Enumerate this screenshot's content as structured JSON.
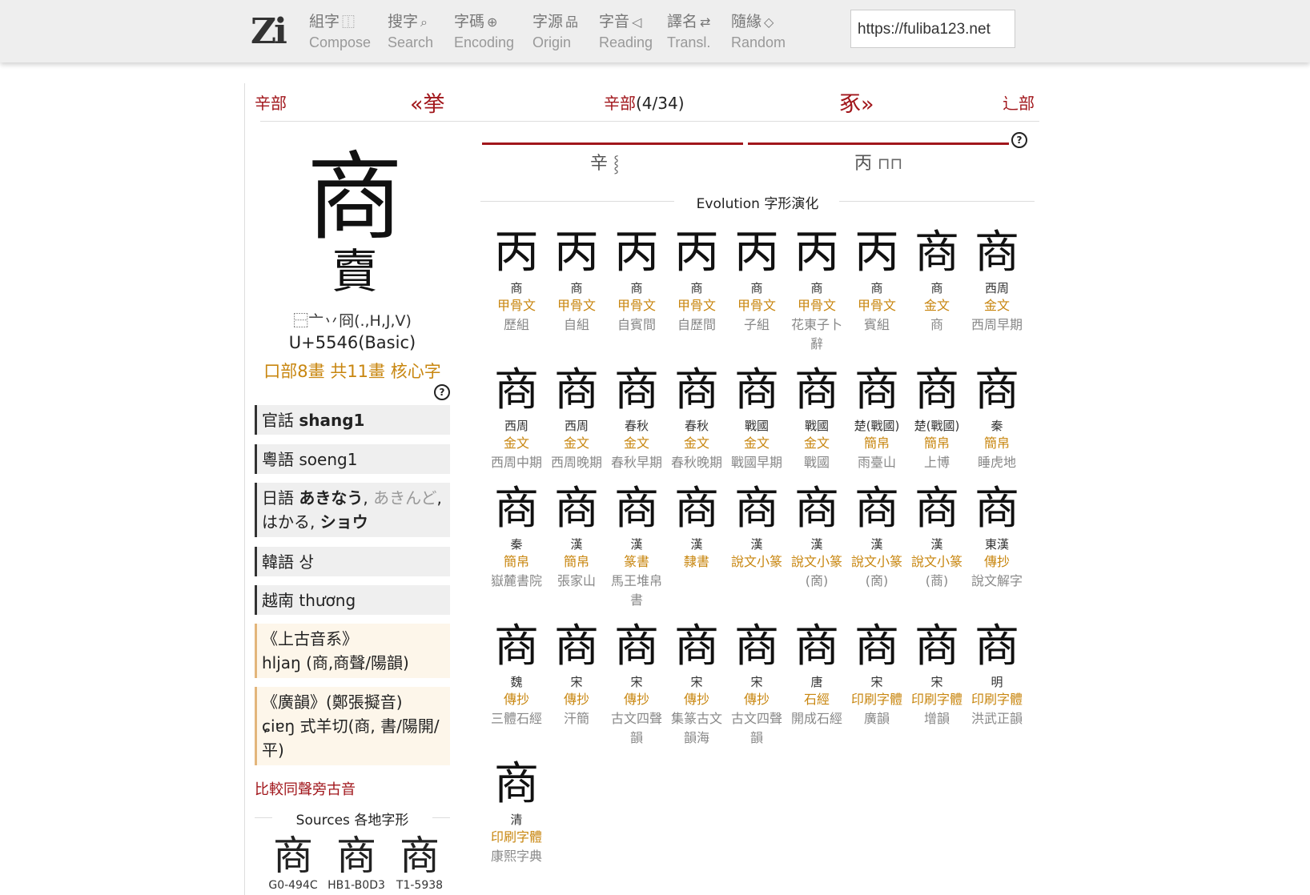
{
  "logo": "Zi",
  "nav": [
    {
      "zh": "組字",
      "icon": "⿰",
      "en": "Compose"
    },
    {
      "zh": "搜字",
      "icon": "⌕",
      "en": "Search"
    },
    {
      "zh": "字碼",
      "icon": "⊕",
      "en": "Encoding"
    },
    {
      "zh": "字源",
      "icon": "品",
      "en": "Origin"
    },
    {
      "zh": "字音",
      "icon": "◁",
      "en": "Reading"
    },
    {
      "zh": "譯名",
      "icon": "⇄",
      "en": "Transl."
    },
    {
      "zh": "隨緣",
      "icon": "◇",
      "en": "Random"
    }
  ],
  "url": "https://fuliba123.net",
  "radical_nav": {
    "prev_radical": "辛部",
    "prev_char": "«挙",
    "current": "辛部",
    "position": "(4/34)",
    "next_char": "豖»",
    "next_radical": "辶部"
  },
  "character": {
    "main": "商",
    "seal": "𧶠",
    "decomposition": "⿱亠丷冏(.,H,J,V)",
    "unicode": "U+5546(Basic)",
    "radical_info": "口部8畫 共11畫 核心字"
  },
  "pronunciations": {
    "mandarin": {
      "label": "官話",
      "value": "shang1"
    },
    "cantonese": {
      "label": "粵語",
      "value": "soeng1"
    },
    "japanese": {
      "label": "日語",
      "kun1": "あきなう",
      "kun2": "あきんど",
      "kun3": "はかる",
      "on": "ショウ"
    },
    "korean": {
      "label": "韓語",
      "value": "상"
    },
    "vietnamese": {
      "label": "越南",
      "value": "thương"
    },
    "old_chinese": {
      "title": "《上古音系》",
      "value": "hljaŋ (商,商聲/陽韻)"
    },
    "guangyun": {
      "title": "《廣韻》(鄭張擬音)",
      "value": "ɕiɐŋ 式羊切(商, 書/陽開/平)"
    }
  },
  "compare_link": "比較同聲旁古音",
  "sources": {
    "title": "Sources 各地字形",
    "items": [
      {
        "char": "商",
        "code": "G0-494C"
      },
      {
        "char": "商",
        "code": "HB1-B0D3"
      },
      {
        "char": "商",
        "code": "T1-5938"
      }
    ]
  },
  "components": [
    {
      "char": "辛",
      "pic": "⸾"
    },
    {
      "char": "丙",
      "pic": "⊓⊓"
    }
  ],
  "evolution": {
    "title": "Evolution 字形演化",
    "items": [
      {
        "glyph": "丙",
        "era": "商",
        "type": "甲骨文",
        "src": "歷組"
      },
      {
        "glyph": "丙",
        "era": "商",
        "type": "甲骨文",
        "src": "自組"
      },
      {
        "glyph": "丙",
        "era": "商",
        "type": "甲骨文",
        "src": "自賓間"
      },
      {
        "glyph": "丙",
        "era": "商",
        "type": "甲骨文",
        "src": "自歷間"
      },
      {
        "glyph": "丙",
        "era": "商",
        "type": "甲骨文",
        "src": "子組"
      },
      {
        "glyph": "丙",
        "era": "商",
        "type": "甲骨文",
        "src": "花東子卜辭"
      },
      {
        "glyph": "丙",
        "era": "商",
        "type": "甲骨文",
        "src": "賓組"
      },
      {
        "glyph": "商",
        "era": "商",
        "type": "金文",
        "src": "商"
      },
      {
        "glyph": "商",
        "era": "西周",
        "type": "金文",
        "src": "西周早期"
      },
      {
        "glyph": "商",
        "era": "西周",
        "type": "金文",
        "src": "西周中期"
      },
      {
        "glyph": "商",
        "era": "西周",
        "type": "金文",
        "src": "西周晚期"
      },
      {
        "glyph": "商",
        "era": "春秋",
        "type": "金文",
        "src": "春秋早期"
      },
      {
        "glyph": "商",
        "era": "春秋",
        "type": "金文",
        "src": "春秋晚期"
      },
      {
        "glyph": "商",
        "era": "戰國",
        "type": "金文",
        "src": "戰國早期"
      },
      {
        "glyph": "商",
        "era": "戰國",
        "type": "金文",
        "src": "戰國"
      },
      {
        "glyph": "商",
        "era": "楚(戰國)",
        "type": "簡帛",
        "src": "雨臺山"
      },
      {
        "glyph": "商",
        "era": "楚(戰國)",
        "type": "簡帛",
        "src": "上博"
      },
      {
        "glyph": "商",
        "era": "秦",
        "type": "簡帛",
        "src": "睡虎地"
      },
      {
        "glyph": "商",
        "era": "秦",
        "type": "簡帛",
        "src": "嶽麓書院"
      },
      {
        "glyph": "商",
        "era": "漢",
        "type": "簡帛",
        "src": "張家山"
      },
      {
        "glyph": "商",
        "era": "漢",
        "type": "篆書",
        "src": "馬王堆帛書"
      },
      {
        "glyph": "商",
        "era": "漢",
        "type": "隸書",
        "src": ""
      },
      {
        "glyph": "商",
        "era": "漢",
        "type": "說文小篆",
        "src": ""
      },
      {
        "glyph": "商",
        "era": "漢",
        "type": "說文小篆",
        "src": "(啇)"
      },
      {
        "glyph": "商",
        "era": "漢",
        "type": "說文小篆",
        "src": "(啇)"
      },
      {
        "glyph": "商",
        "era": "漢",
        "type": "說文小篆",
        "src": "(蔏)"
      },
      {
        "glyph": "商",
        "era": "東漢",
        "type": "傳抄",
        "src": "說文解字"
      },
      {
        "glyph": "商",
        "era": "魏",
        "type": "傳抄",
        "src": "三體石經"
      },
      {
        "glyph": "商",
        "era": "宋",
        "type": "傳抄",
        "src": "汗簡"
      },
      {
        "glyph": "商",
        "era": "宋",
        "type": "傳抄",
        "src": "古文四聲韻"
      },
      {
        "glyph": "商",
        "era": "宋",
        "type": "傳抄",
        "src": "集篆古文韻海"
      },
      {
        "glyph": "商",
        "era": "宋",
        "type": "傳抄",
        "src": "古文四聲韻"
      },
      {
        "glyph": "商",
        "era": "唐",
        "type": "石經",
        "src": "開成石經"
      },
      {
        "glyph": "商",
        "era": "宋",
        "type": "印刷字體",
        "src": "廣韻"
      },
      {
        "glyph": "商",
        "era": "宋",
        "type": "印刷字體",
        "src": "增韻"
      },
      {
        "glyph": "商",
        "era": "明",
        "type": "印刷字體",
        "src": "洪武正韻"
      },
      {
        "glyph": "商",
        "era": "清",
        "type": "印刷字體",
        "src": "康熙字典"
      }
    ]
  }
}
